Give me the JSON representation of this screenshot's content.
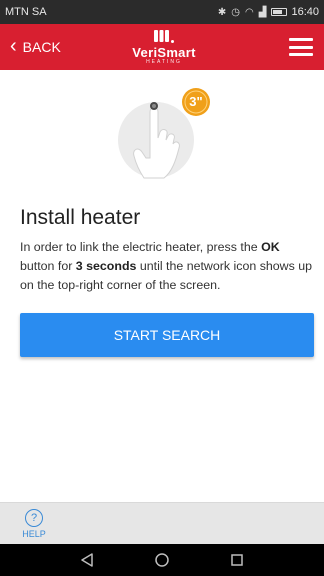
{
  "status_bar": {
    "carrier": "MTN SA",
    "time": "16:40",
    "icons": [
      "signal-icon",
      "bluetooth-icon",
      "nfc-icon",
      "alarm-icon",
      "vibrate-icon",
      "wifi-icon",
      "cell-signal-icon",
      "battery-icon"
    ]
  },
  "header": {
    "back_label": "BACK",
    "logo_text": "VeriSmart",
    "logo_subtext": "HEATING",
    "background_color": "#d81f30"
  },
  "illustration": {
    "badge_text": "3\""
  },
  "main": {
    "title": "Install heater",
    "instructions": {
      "part1": "In order to link the electric heater, press the ",
      "bold1": "OK",
      "part2": " button for ",
      "bold2": "3 seconds",
      "part3": " until the network icon shows up on the top-right corner of the screen."
    },
    "start_search_label": "START SEARCH",
    "button_color": "#2a8cf0"
  },
  "help": {
    "icon_glyph": "?",
    "label": "HELP"
  },
  "nav": {
    "items": [
      "back-nav-icon",
      "home-nav-icon",
      "recents-nav-icon"
    ]
  }
}
